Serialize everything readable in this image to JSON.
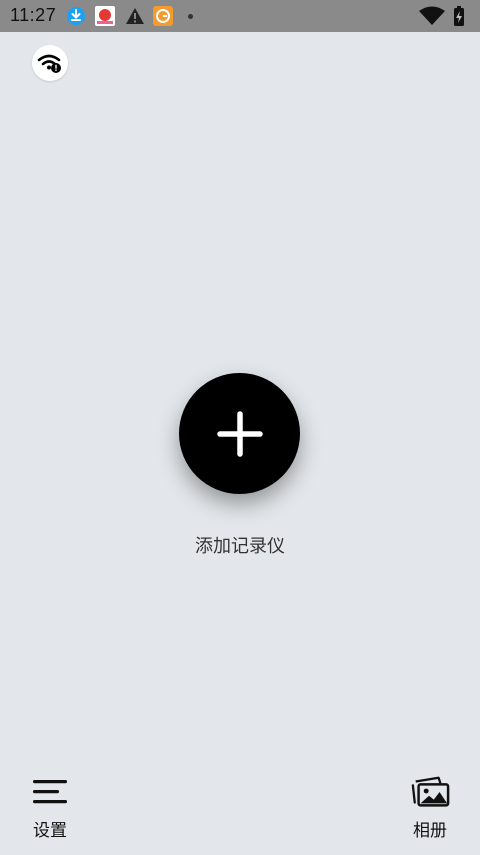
{
  "status_bar": {
    "time": "11:27",
    "notification_icons": [
      "download-icon",
      "red-app-icon",
      "warning-icon",
      "orange-app-icon"
    ],
    "right_icons": [
      "wifi-icon",
      "battery-charging-icon"
    ]
  },
  "top_left_button": {
    "icon": "wifi-warning-icon"
  },
  "main": {
    "add_button_icon": "plus-icon",
    "add_label": "添加记录仪"
  },
  "bottom_nav": {
    "settings_label": "设置",
    "album_label": "相册"
  },
  "colors": {
    "background": "#e3e7eb",
    "status_bar": "#8a8a8a",
    "add_button": "#000000",
    "download_icon": "#1da1f2",
    "orange_app": "#f39b2f"
  }
}
